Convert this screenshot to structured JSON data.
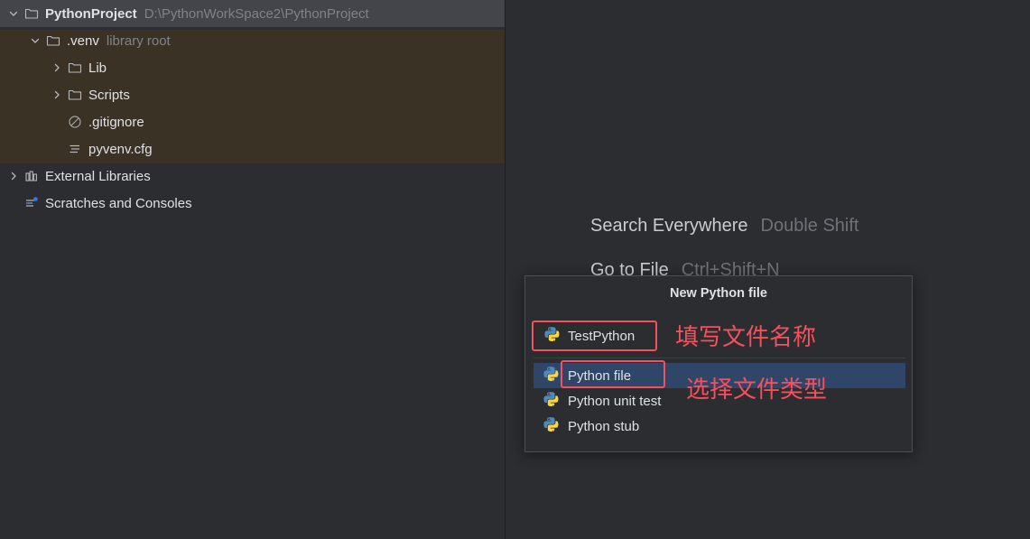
{
  "sidebar": {
    "tree": [
      {
        "id": "project-root",
        "name": "project-root-node",
        "label": "PythonProject",
        "hint": "D:\\PythonWorkSpace2\\PythonProject",
        "icon": "folder-icon",
        "arrow": "chevron-down-icon",
        "indent": 0,
        "selected": true,
        "bold": true
      },
      {
        "id": "venv",
        "name": "tree-node-venv",
        "label": ".venv",
        "hint": "library root",
        "icon": "folder-icon",
        "arrow": "chevron-down-icon",
        "indent": 1,
        "selected": false,
        "bold": false
      },
      {
        "id": "lib",
        "name": "tree-node-lib",
        "label": "Lib",
        "hint": "",
        "icon": "folder-icon",
        "arrow": "chevron-right-icon",
        "indent": 2,
        "selected": false,
        "bold": false
      },
      {
        "id": "scripts",
        "name": "tree-node-scripts",
        "label": "Scripts",
        "hint": "",
        "icon": "folder-icon",
        "arrow": "chevron-right-icon",
        "indent": 2,
        "selected": false,
        "bold": false
      },
      {
        "id": "gitignore",
        "name": "tree-node-gitignore",
        "label": ".gitignore",
        "hint": "",
        "icon": "gitignore-icon",
        "arrow": "",
        "indent": 2,
        "selected": false,
        "bold": false
      },
      {
        "id": "pyvenvcfg",
        "name": "tree-node-pyvenv-cfg",
        "label": "pyvenv.cfg",
        "hint": "",
        "icon": "config-file-icon",
        "arrow": "",
        "indent": 2,
        "selected": false,
        "bold": false
      },
      {
        "id": "external-libraries",
        "name": "tree-node-external-libraries",
        "label": "External Libraries",
        "hint": "",
        "icon": "library-icon",
        "arrow": "chevron-right-icon",
        "indent": 0,
        "selected": false,
        "bold": false
      },
      {
        "id": "scratches",
        "name": "tree-node-scratches-and-consoles",
        "label": "Scratches and Consoles",
        "hint": "",
        "icon": "scratches-icon",
        "arrow": "",
        "indent": 0,
        "selected": false,
        "bold": false
      }
    ]
  },
  "editor": {
    "hints": [
      {
        "action": "Search Everywhere",
        "key": "Double Shift"
      },
      {
        "action": "Go to File",
        "key": "Ctrl+Shift+N"
      }
    ]
  },
  "dialog": {
    "title": "New Python file",
    "name_input": {
      "value": "TestPython",
      "placeholder": "",
      "icon": "python-file-icon"
    },
    "file_types": [
      {
        "label": "Python file",
        "icon": "python-file-icon",
        "selected": true
      },
      {
        "label": "Python unit test",
        "icon": "python-file-icon",
        "selected": false
      },
      {
        "label": "Python stub",
        "icon": "python-file-icon",
        "selected": false
      }
    ]
  },
  "annotations": {
    "color": "#f4505e",
    "name_hint": "填写文件名称",
    "type_hint": "选择文件类型"
  },
  "colors": {
    "editor_background": "#2b2d30",
    "sidebar_selected": "#43454a",
    "venv_band": "#3b3226",
    "list_selected": "#2f4668",
    "annotation_red": "#f4505e"
  }
}
